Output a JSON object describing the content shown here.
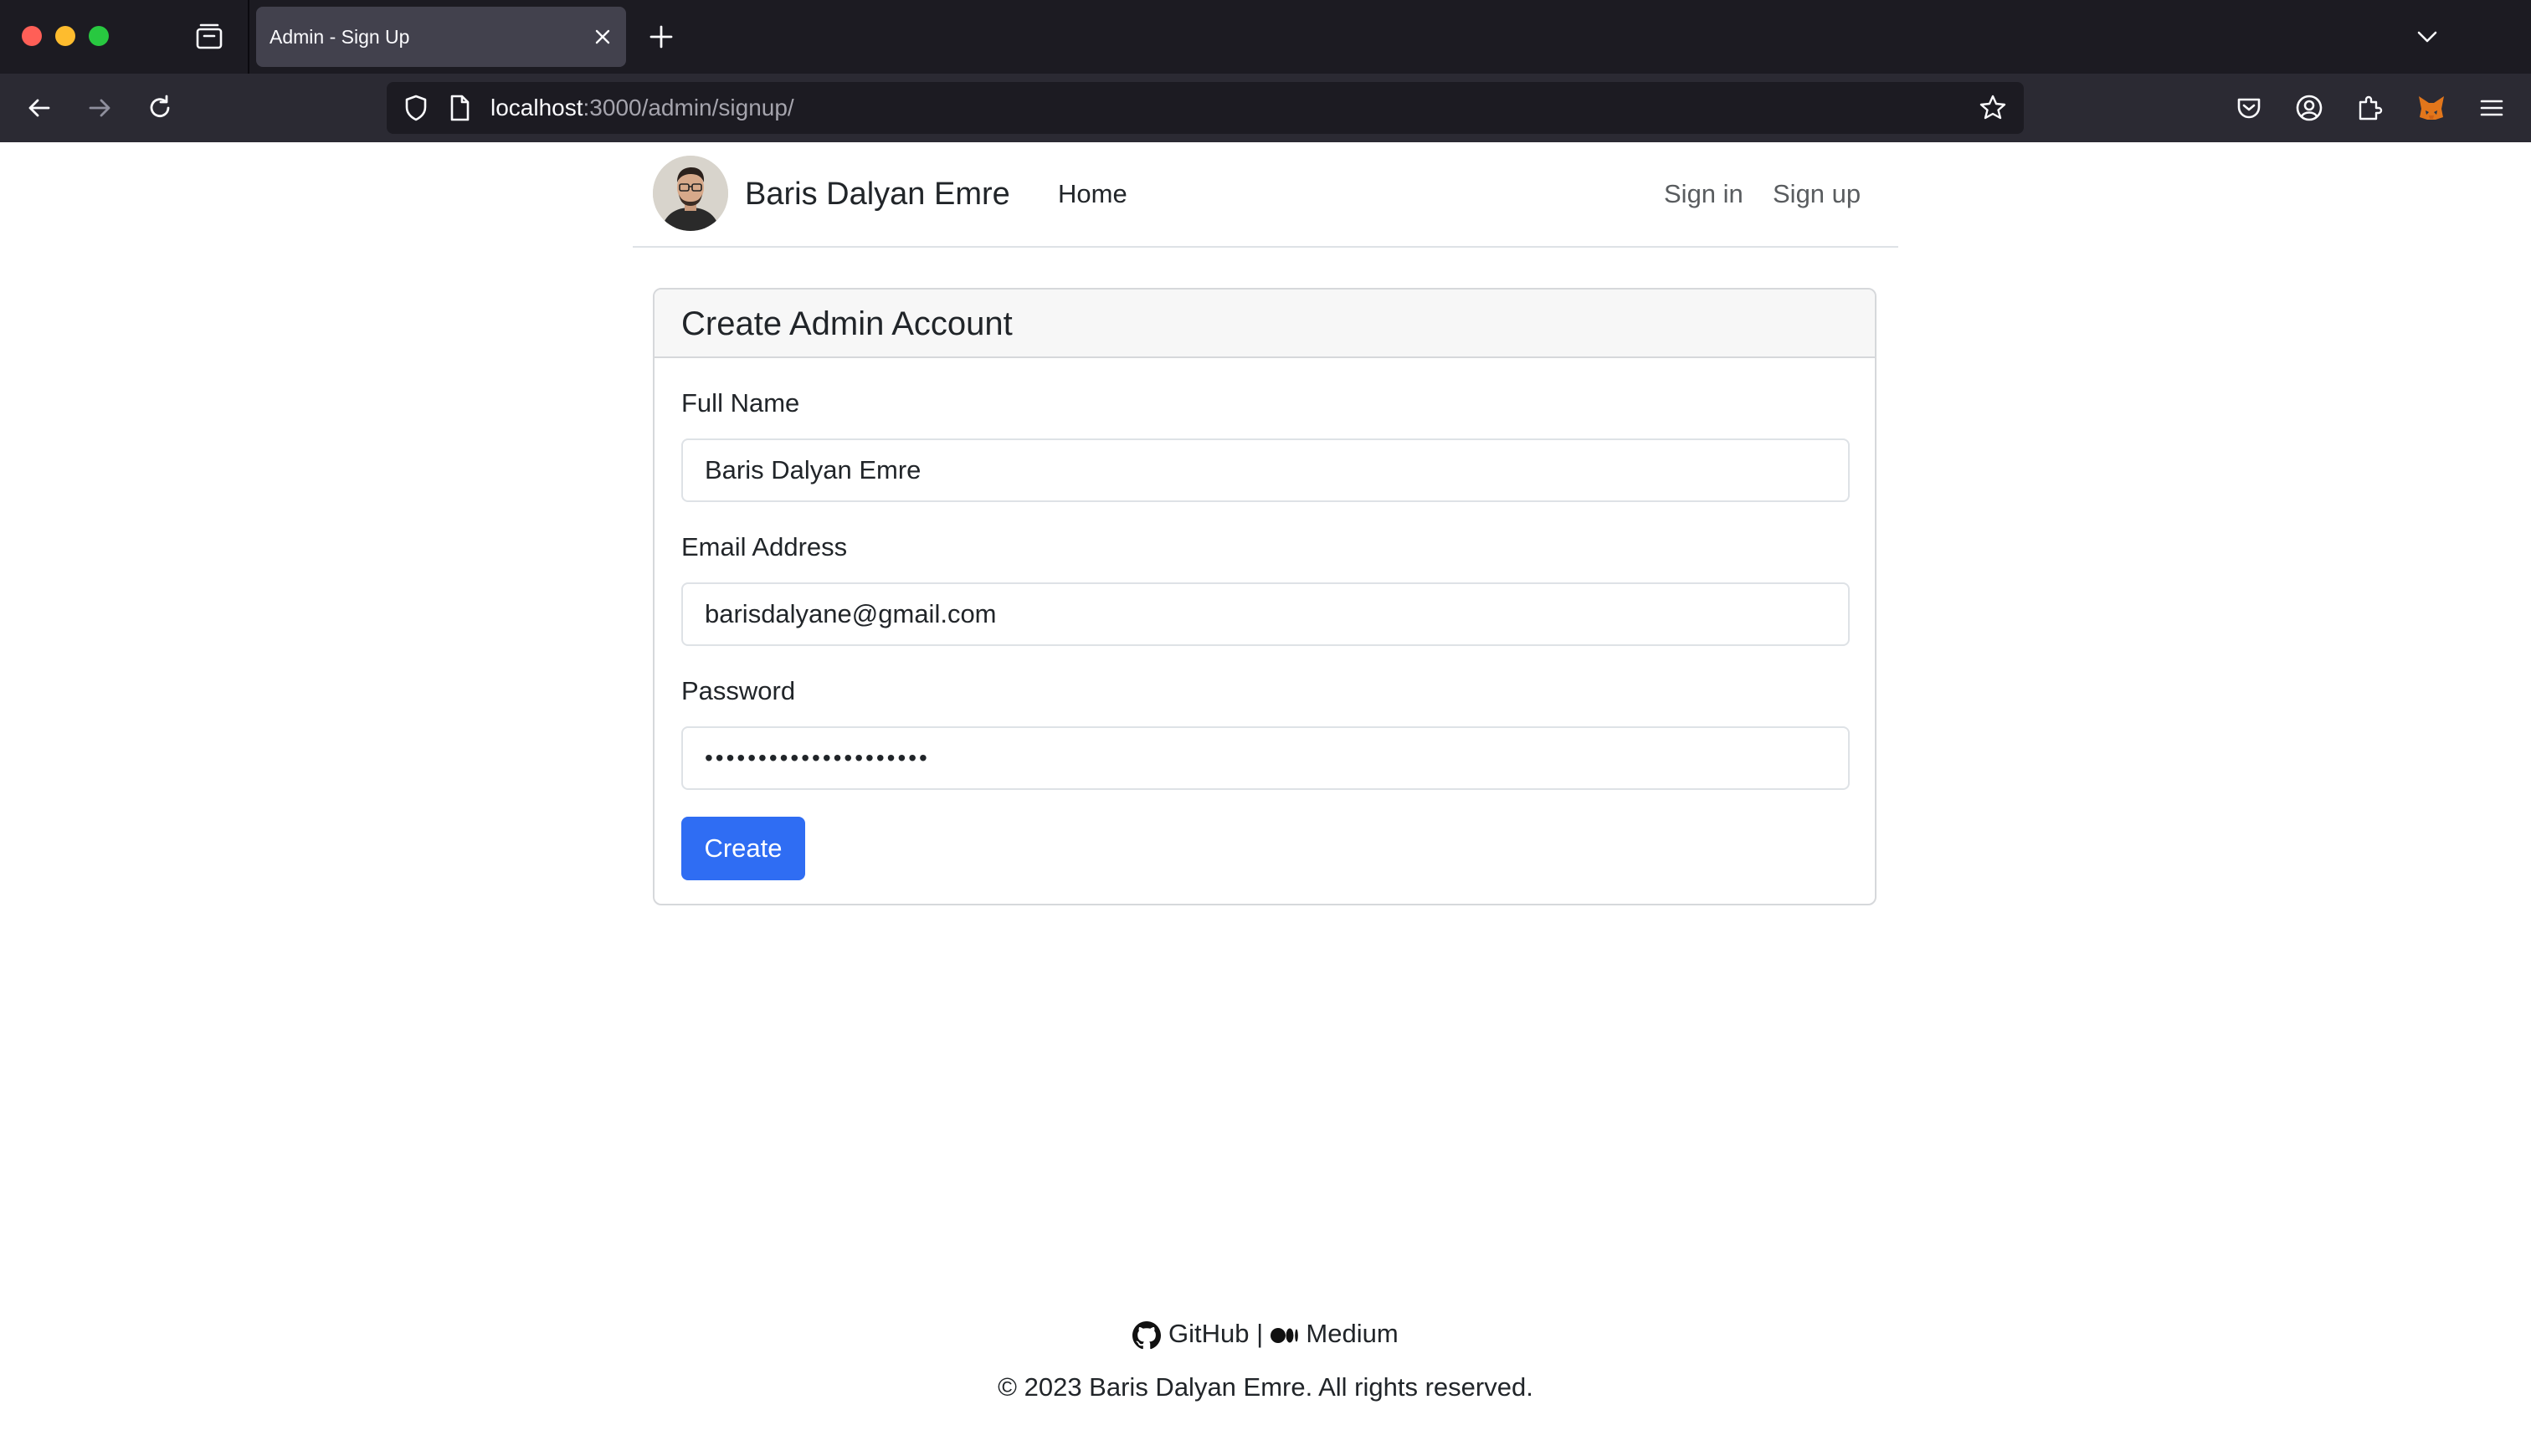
{
  "browser": {
    "tab_title": "Admin - Sign Up",
    "url_host": "localhost",
    "url_path": ":3000/admin/signup/"
  },
  "header": {
    "brand": "Baris Dalyan Emre",
    "nav_home": "Home",
    "nav_signin": "Sign in",
    "nav_signup": "Sign up"
  },
  "form": {
    "title": "Create Admin Account",
    "fullname_label": "Full Name",
    "fullname_value": "Baris Dalyan Emre",
    "email_label": "Email Address",
    "email_value": "barisdalyane@gmail.com",
    "password_label": "Password",
    "password_value": "•••••••••••••••••••••",
    "submit_label": "Create"
  },
  "footer": {
    "github_label": "GitHub",
    "separator": "|",
    "medium_label": "Medium",
    "copyright": "© 2023 Baris Dalyan Emre. All rights reserved."
  },
  "colors": {
    "primary": "#2f6df3",
    "chrome_dark": "#1c1b22",
    "toolbar": "#2b2a33"
  }
}
